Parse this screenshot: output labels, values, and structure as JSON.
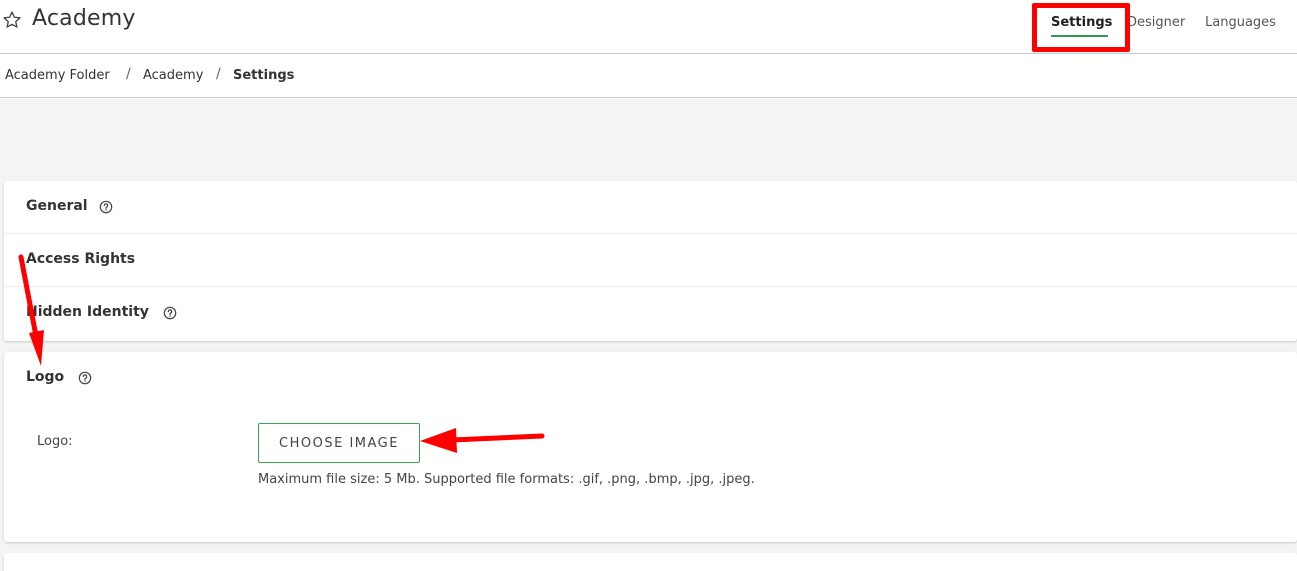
{
  "header": {
    "title": "Academy",
    "star_icon": "star-outline-icon",
    "tabs": [
      {
        "label": "Settings",
        "active": true
      },
      {
        "label": "Designer",
        "active": false
      },
      {
        "label": "Languages",
        "active": false
      }
    ]
  },
  "breadcrumb": {
    "items": [
      "Academy Folder",
      "Academy",
      "Settings"
    ],
    "separator": "/"
  },
  "sections": {
    "general": {
      "title": "General",
      "has_help": true
    },
    "access_rights": {
      "title": "Access Rights",
      "has_help": false
    },
    "hidden_identity": {
      "title": "Hidden Identity",
      "has_help": true
    },
    "logo": {
      "title": "Logo",
      "has_help": true,
      "field_label": "Logo:",
      "button_label": "CHOOSE IMAGE",
      "hint": "Maximum file size: 5 Mb. Supported file formats: .gif, .png, .bmp, .jpg, .jpeg."
    }
  },
  "colors": {
    "accent": "#2e9c4a",
    "annotation": "#ff0000",
    "background": "#f4f4f4"
  }
}
